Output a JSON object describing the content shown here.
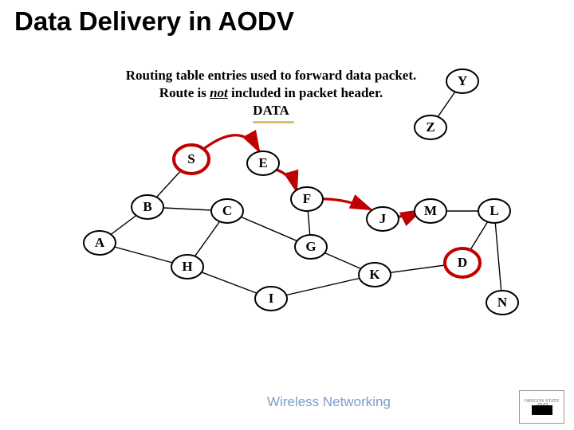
{
  "title": "Data Delivery in AODV",
  "description": {
    "line1": "Routing table entries used to forward data packet.",
    "line2a": "Route is ",
    "line2_not": "not",
    "line2b": " included in packet header.",
    "line3": "DATA"
  },
  "nodes": {
    "S": "S",
    "E": "E",
    "F": "F",
    "B": "B",
    "C": "C",
    "J": "J",
    "M": "M",
    "L": "L",
    "A": "A",
    "G": "G",
    "H": "H",
    "K": "K",
    "D": "D",
    "I": "I",
    "N": "N",
    "Y": "Y",
    "Z": "Z"
  },
  "footer": "Wireless Networking",
  "page": "39",
  "corner": "OREGON STATE"
}
